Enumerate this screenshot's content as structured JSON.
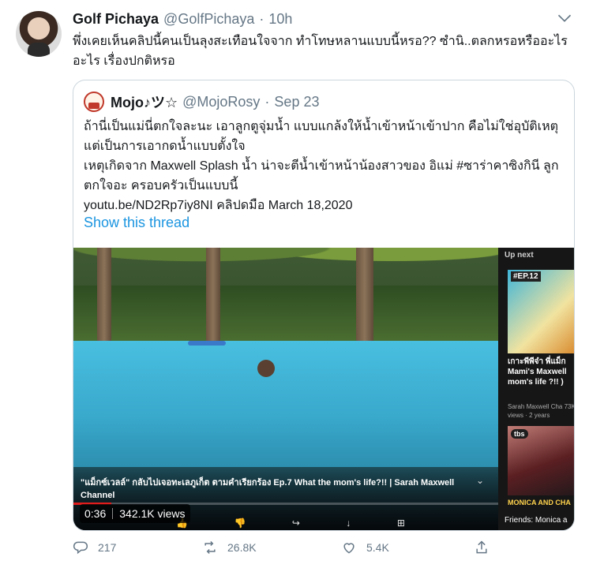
{
  "tweet": {
    "author_name": "Golf Pichaya",
    "author_handle": "@GolfPichaya",
    "separator": "·",
    "time": "10h",
    "text": "พึ่งเคยเห็นคลิปนี้คนเป็นลุงสะเทือนใจจาก ทำโทษหลานแบบนี้หรอ?? ซำนิ..ตลกหรอหรืออะไรอะไร เรื่องปกติหรอ"
  },
  "quote": {
    "author_name": "Mojo♪ツ☆",
    "author_handle": "@MojoRosy",
    "separator": "·",
    "time": "Sep 23",
    "lines": [
      "ถ้านี่เป็นแม่นี่ตกใจละนะ เอาลูกตูจุ่มน้ำ แบบแกล้งให้น้ำเข้าหน้าเข้าปาก คือไม่ใช่อุบัติเหตุแต่เป็นการเอากดน้ำแบบตั้งใจ",
      "เหตุเกิดจาก Maxwell Splash น้ำ น่าจะตีน้ำเข้าหน้าน้องสาวของ อิแม่ #ซาร่าคาซิงกินี ลูกตกใจอะ ครอบครัวเป็นแบบนี้",
      "youtu.be/ND2Rp7iy8NI  คลิปดมือ March 18,2020"
    ],
    "show_thread": "Show this thread"
  },
  "video": {
    "caption": "\"แม็กซ์เวลล์\" กลับไปเจอทะเลภูเก็ต ตามคำเรียกร้อง Ep.7 What the mom's life?!! | Sarah Maxwell Channel",
    "duration": "0:36",
    "views": "342.1K views",
    "progress": 0.09,
    "upnext_label": "Up next",
    "upnext_ep": "#EP.12",
    "upnext_title": "เกาะพีพีจ๋า พี่แม็ก Mami's Maxwell mom's life ?!! )",
    "upnext_meta": "Sarah Maxwell Cha 73K views · 2 years",
    "upnext_badge": "tbs",
    "upnext2_label": "MONICA AND CHA",
    "upnext2_title": "Friends: Monica a"
  },
  "actions": {
    "reply_count": "217",
    "retweet_count": "26.8K",
    "like_count": "5.4K"
  },
  "colors": {
    "accent": "#1b95e0",
    "muted": "#657786",
    "border": "#ccd6dd"
  }
}
